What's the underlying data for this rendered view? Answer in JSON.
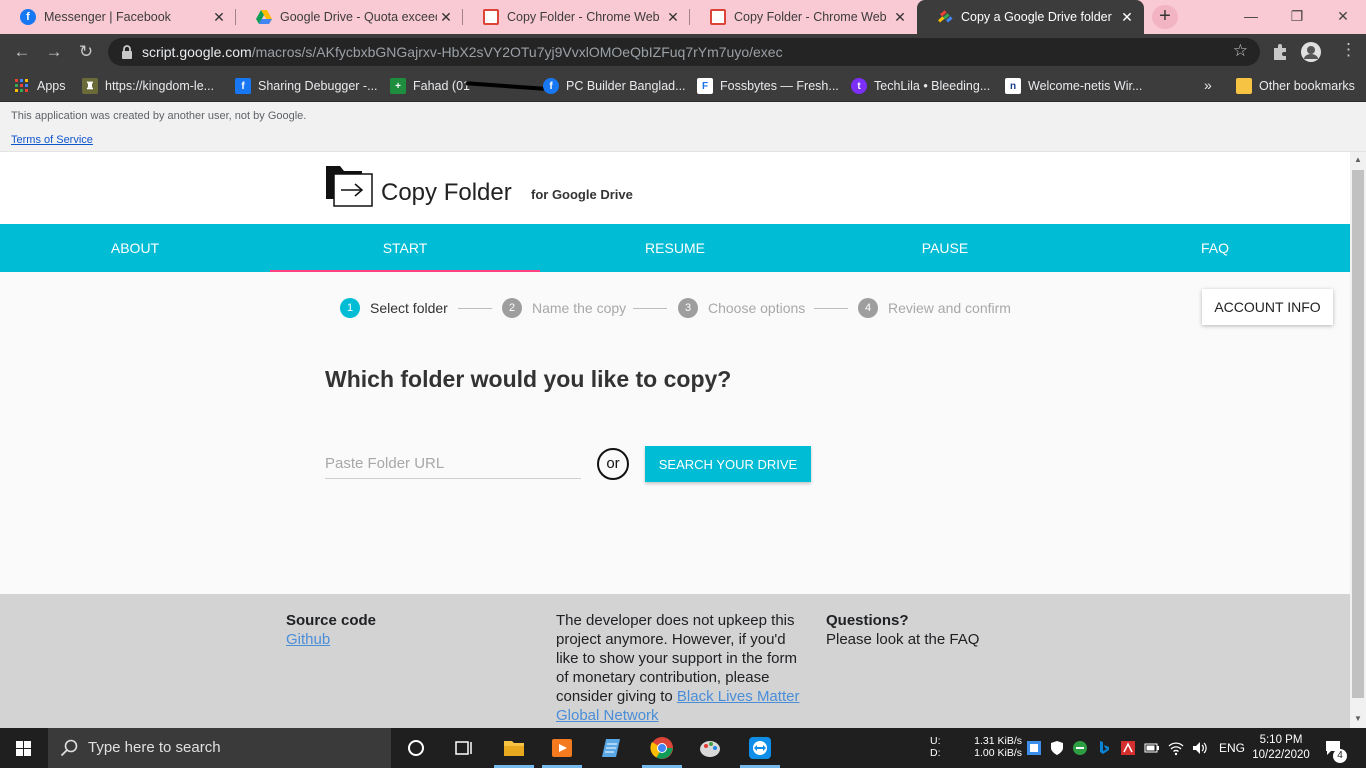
{
  "browser": {
    "tabs": [
      {
        "title": "Messenger | Facebook",
        "icon": "facebook-icon",
        "active": false
      },
      {
        "title": "Google Drive - Quota exceeded",
        "icon": "google-drive-icon",
        "active": false
      },
      {
        "title": "Copy Folder - Chrome Web Store",
        "icon": "chrome-web-store-icon",
        "active": false
      },
      {
        "title": "Copy Folder - Chrome Web Store",
        "icon": "chrome-web-store-icon",
        "active": false
      },
      {
        "title": "Copy a Google Drive folder",
        "icon": "apps-script-icon",
        "active": true
      }
    ],
    "url": {
      "host": "script.google.com",
      "path": "/macros/s/AKfycbxbGNGajrxv-HbX2sVY2OTu7yj9VvxlOMOeQbIZFuq7rYm7uyo/exec"
    },
    "bookmarks": [
      {
        "label": "Apps",
        "icon": "apps-grid-icon"
      },
      {
        "label": "https://kingdom-le...",
        "icon": "kingdom-icon"
      },
      {
        "label": "Sharing Debugger -...",
        "icon": "facebook-icon"
      },
      {
        "label": "Fahad (01",
        "icon": "plus-cross-icon"
      },
      {
        "label": "PC Builder Banglad...",
        "icon": "facebook-icon"
      },
      {
        "label": "Fossbytes — Fresh...",
        "icon": "fossbytes-icon"
      },
      {
        "label": "TechLila • Bleeding...",
        "icon": "techlila-icon"
      },
      {
        "label": "Welcome-netis Wir...",
        "icon": "netis-icon"
      }
    ],
    "other_bookmarks": "Other bookmarks"
  },
  "notice": {
    "message": "This application was created by another user, not by Google.",
    "terms": "Terms of Service"
  },
  "app": {
    "title": "Copy Folder",
    "subtitle": "for Google Drive",
    "nav": [
      "ABOUT",
      "START",
      "RESUME",
      "PAUSE",
      "FAQ"
    ],
    "active_nav": "START",
    "steps": [
      {
        "num": "1",
        "label": "Select folder",
        "active": true
      },
      {
        "num": "2",
        "label": "Name the copy",
        "active": false
      },
      {
        "num": "3",
        "label": "Choose options",
        "active": false
      },
      {
        "num": "4",
        "label": "Review and confirm",
        "active": false
      }
    ],
    "account_button": "ACCOUNT INFO",
    "question": "Which folder would you like to copy?",
    "input_placeholder": "Paste Folder URL",
    "input_value": "",
    "or_label": "or",
    "search_button": "SEARCH YOUR DRIVE",
    "footer": {
      "source_heading": "Source code",
      "source_link": "Github",
      "support_text": "The developer does not upkeep this project anymore. However, if you'd like to show your support in the form of monetary contribution, please consider giving to",
      "support_link": "Black Lives Matter Global Network",
      "questions_heading": "Questions?",
      "questions_text": "Please look at the FAQ"
    }
  },
  "taskbar": {
    "search_placeholder": "Type here to search",
    "net_up_label": "U:",
    "net_down_label": "D:",
    "net_up": "1.31 KiB/s",
    "net_down": "1.00 KiB/s",
    "language": "ENG",
    "time": "5:10 PM",
    "date": "10/22/2020",
    "notifications": "4"
  },
  "colors": {
    "accent": "#00bcd4",
    "tab_ink": "#ff4081",
    "tabstrip": "#f9c9d4",
    "chrome_dark": "#3c3c3c",
    "footer": "#d3d3d3"
  }
}
